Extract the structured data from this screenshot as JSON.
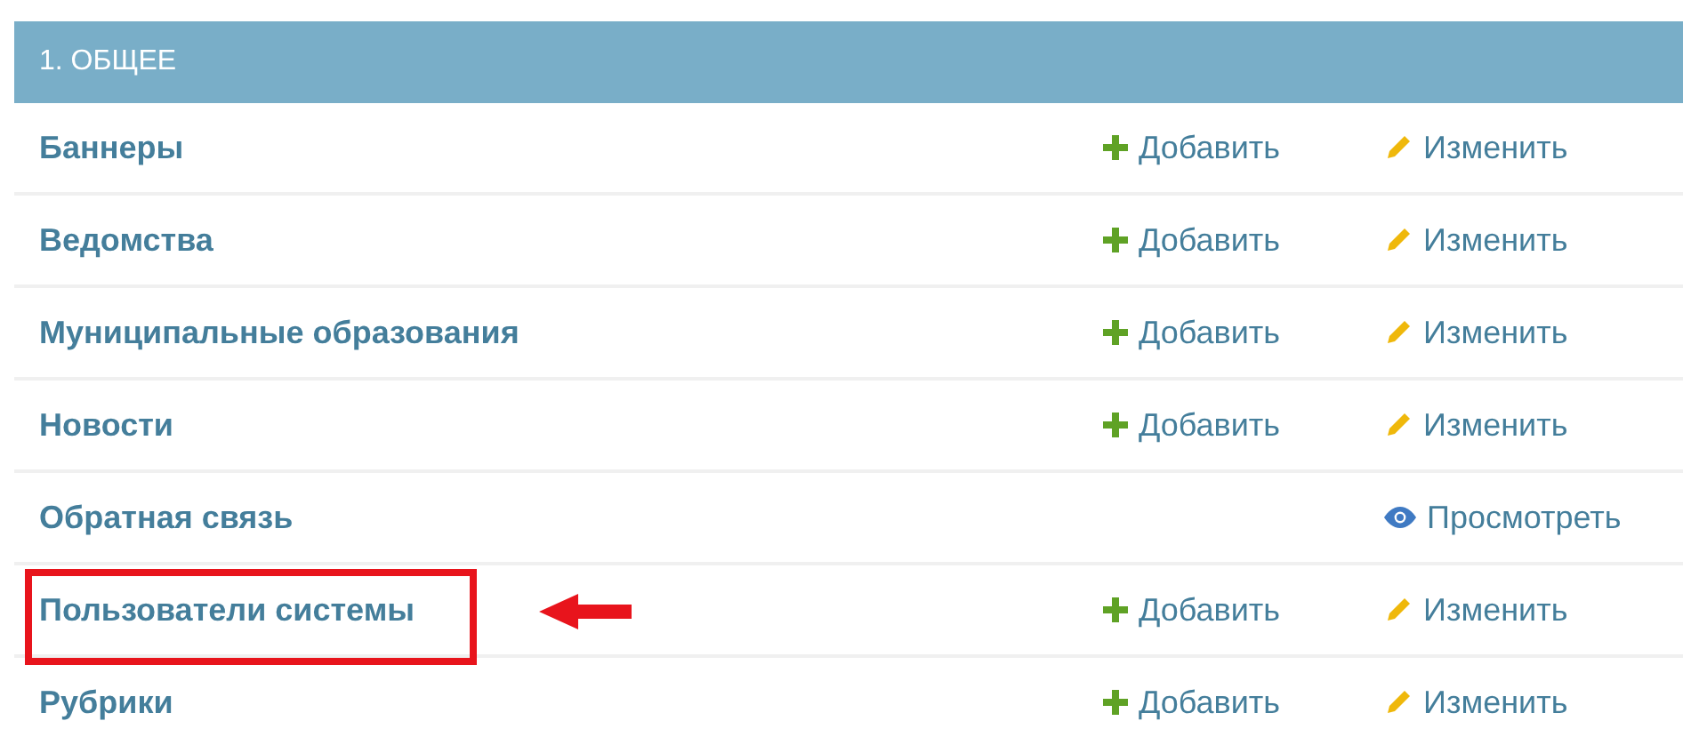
{
  "section": {
    "title": "1. ОБЩЕЕ"
  },
  "rows": [
    {
      "name": "Баннеры",
      "highlighted": false,
      "actions": [
        {
          "kind": "add",
          "label": "Добавить"
        },
        {
          "kind": "change",
          "label": "Изменить"
        }
      ]
    },
    {
      "name": "Ведомства",
      "highlighted": false,
      "actions": [
        {
          "kind": "add",
          "label": "Добавить"
        },
        {
          "kind": "change",
          "label": "Изменить"
        }
      ]
    },
    {
      "name": "Муниципальные образования",
      "highlighted": false,
      "actions": [
        {
          "kind": "add",
          "label": "Добавить"
        },
        {
          "kind": "change",
          "label": "Изменить"
        }
      ]
    },
    {
      "name": "Новости",
      "highlighted": false,
      "actions": [
        {
          "kind": "add",
          "label": "Добавить"
        },
        {
          "kind": "change",
          "label": "Изменить"
        }
      ]
    },
    {
      "name": "Обратная связь",
      "highlighted": false,
      "actions": [
        {
          "kind": "view",
          "label": "Просмотреть"
        }
      ]
    },
    {
      "name": "Пользователи системы",
      "highlighted": true,
      "actions": [
        {
          "kind": "add",
          "label": "Добавить"
        },
        {
          "kind": "change",
          "label": "Изменить"
        }
      ]
    },
    {
      "name": "Рубрики",
      "highlighted": false,
      "actions": [
        {
          "kind": "add",
          "label": "Добавить"
        },
        {
          "kind": "change",
          "label": "Изменить"
        }
      ]
    }
  ]
}
